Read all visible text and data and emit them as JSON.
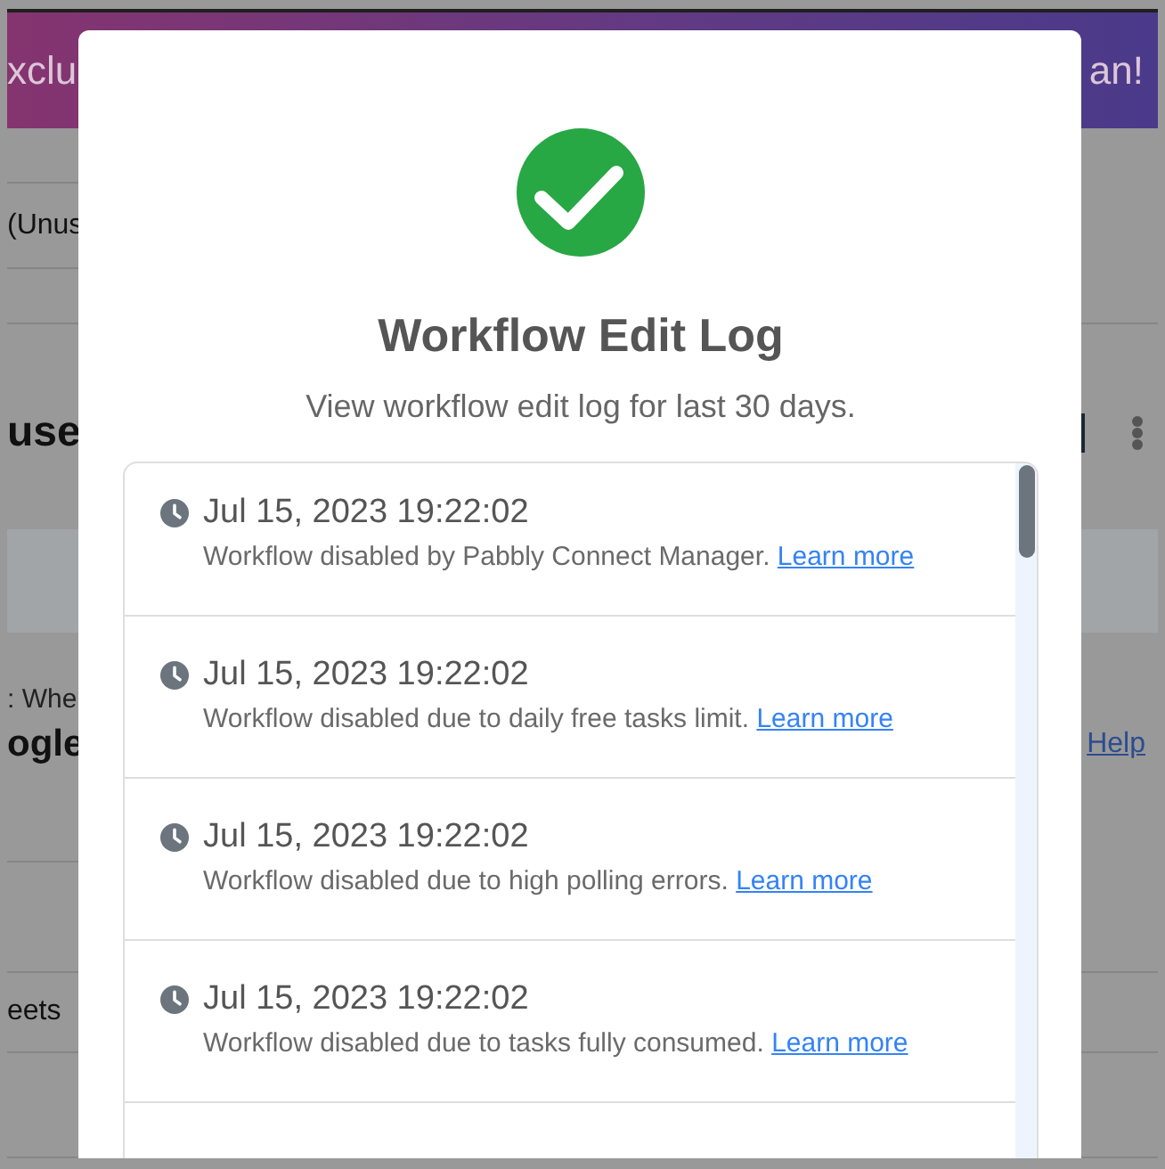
{
  "background_page": {
    "banner": {
      "left_text": "xclu",
      "right_text": "an!"
    },
    "row_label": "(Unus",
    "heading": "use",
    "field_label": ": Whe",
    "app_name": "ogle",
    "help_link": "Help",
    "sheet_label": "eets"
  },
  "modal": {
    "title": "Workflow Edit Log",
    "subtitle": "View workflow edit log for last 30 days.",
    "entries": [
      {
        "timestamp": "Jul 15, 2023 19:22:02",
        "message": "Workflow disabled by Pabbly Connect Manager.",
        "link": "Learn more"
      },
      {
        "timestamp": "Jul 15, 2023 19:22:02",
        "message": "Workflow disabled due to daily free tasks limit.",
        "link": "Learn more"
      },
      {
        "timestamp": "Jul 15, 2023 19:22:02",
        "message": "Workflow disabled due to high polling errors.",
        "link": "Learn more"
      },
      {
        "timestamp": "Jul 15, 2023 19:22:02",
        "message": "Workflow disabled due to tasks fully consumed.",
        "link": "Learn more"
      }
    ]
  }
}
